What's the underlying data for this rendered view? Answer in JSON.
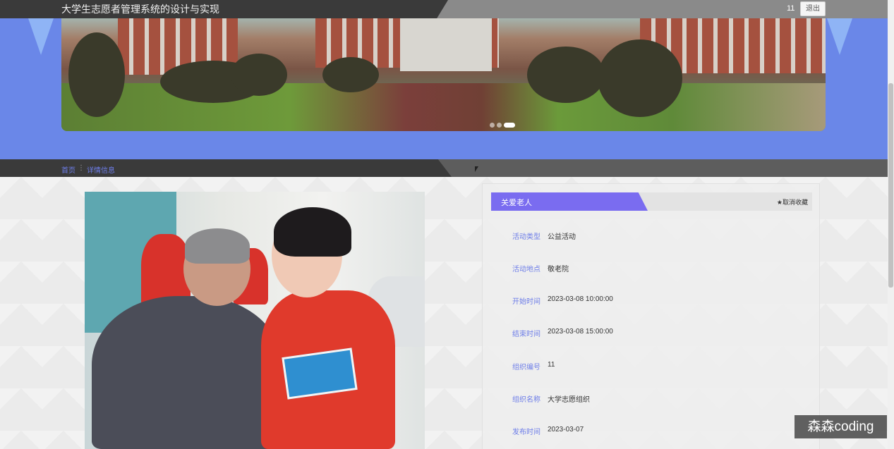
{
  "header": {
    "title": "大学生志愿者管理系统的设计与实现",
    "user_id": "11",
    "logout_label": "退出"
  },
  "banner": {
    "slide_count": 3,
    "active_slide": 3
  },
  "breadcrumb": {
    "home": "首页",
    "separator": "⋮",
    "current": "详情信息"
  },
  "detail": {
    "title": "关爱老人",
    "favorite_label": "★取消收藏",
    "fields": [
      {
        "label": "活动类型",
        "value": "公益活动"
      },
      {
        "label": "活动地点",
        "value": "敬老院"
      },
      {
        "label": "开始时间",
        "value": "2023-03-08 10:00:00"
      },
      {
        "label": "结束时间",
        "value": "2023-03-08 15:00:00"
      },
      {
        "label": "组织编号",
        "value": "11"
      },
      {
        "label": "组织名称",
        "value": "大学志愿组织"
      },
      {
        "label": "发布时间",
        "value": "2023-03-07"
      }
    ]
  },
  "watermark": "森森coding",
  "colors": {
    "accent": "#7a6cf0",
    "link": "#6d7de8",
    "banner_bg": "#6a87e8"
  }
}
